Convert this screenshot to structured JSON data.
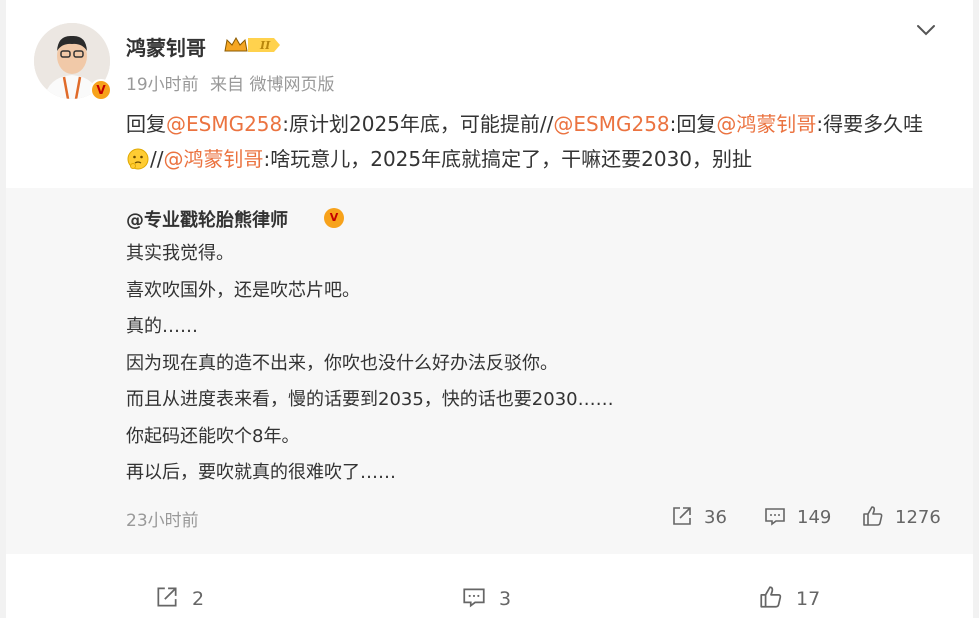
{
  "post": {
    "username": "鸿蒙钊哥",
    "time": "19小时前",
    "source": "来自 微博网页版",
    "text": [
      {
        "t": "回复",
        "mention": false
      },
      {
        "t": "@ESMG258",
        "mention": true
      },
      {
        "t": ":原计划2025年底，可能提前//",
        "mention": false
      },
      {
        "t": "@ESMG258",
        "mention": true
      },
      {
        "t": ":回复",
        "mention": false
      },
      {
        "t": "@鸿蒙钊哥",
        "mention": true
      },
      {
        "t": ":得要多久哇",
        "mention": false
      },
      {
        "t": "[emoji]",
        "mention": false
      },
      {
        "t": "//",
        "mention": false
      },
      {
        "t": "@鸿蒙钊哥",
        "mention": true
      },
      {
        "t": ":啥玩意儿，2025年底就搞定了，干嘛还要2030，别扯",
        "mention": false
      }
    ]
  },
  "repost": {
    "username": "@专业戳轮胎熊律师",
    "lines": [
      "其实我觉得。",
      "喜欢吹国外，还是吹芯片吧。",
      "真的……",
      "因为现在真的造不出来，你吹也没什么好办法反驳你。",
      "而且从进度表来看，慢的话要到2035，快的话也要2030……",
      "你起码还能吹个8年。",
      "再以后，要吹就真的很难吹了……"
    ],
    "time": "23小时前",
    "shares": "36",
    "comments": "149",
    "likes": "1276"
  },
  "actions": {
    "shares": "2",
    "comments": "3",
    "likes": "17"
  },
  "colors": {
    "mention": "#eb7340",
    "badge": "#f7a21b",
    "card_bg": "#ffffff",
    "repost_bg": "#f7f7f7"
  }
}
